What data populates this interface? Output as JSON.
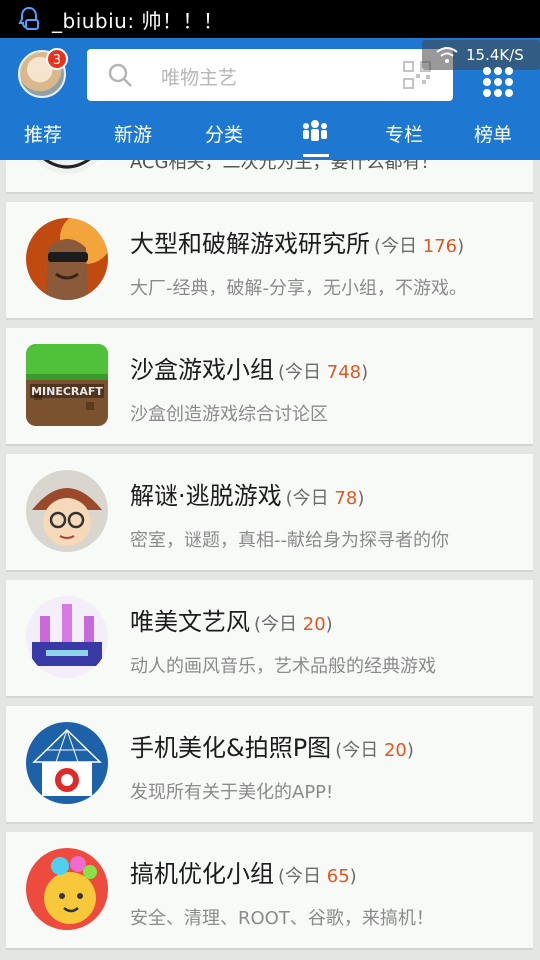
{
  "status_bar": {
    "notification": "_biubiu: 帅！！！",
    "network_speed": "15.4K/S"
  },
  "header": {
    "badge_count": "3",
    "search_placeholder": "唯物主艺",
    "tabs": [
      "推荐",
      "新游",
      "分类",
      "专栏",
      "榜单"
    ],
    "active_tab_icon": "group-icon"
  },
  "partial_item": {
    "desc": "ACG相关，二次元为主，要什么都有！"
  },
  "groups": [
    {
      "title": "大型和破解游戏研究所",
      "today_label": "今日",
      "today_count": "176",
      "desc": "大厂-经典，破解-分享，无小组，不游戏。"
    },
    {
      "title": "沙盒游戏小组",
      "today_label": "今日",
      "today_count": "748",
      "desc": "沙盒创造游戏综合讨论区"
    },
    {
      "title": "解谜·逃脱游戏",
      "today_label": "今日",
      "today_count": "78",
      "desc": "密室，谜题，真相--献给身为探寻者的你"
    },
    {
      "title": "唯美文艺风",
      "today_label": "今日",
      "today_count": "20",
      "desc": "动人的画风音乐，艺术品般的经典游戏"
    },
    {
      "title": "手机美化&拍照P图",
      "today_label": "今日",
      "today_count": "20",
      "desc": "发现所有关于美化的APP!"
    },
    {
      "title": "搞机优化小组",
      "today_label": "今日",
      "today_count": "65",
      "desc": "安全、清理、ROOT、谷歌，来搞机！"
    }
  ],
  "colors": {
    "header": "#1e78d2",
    "today_count": "#e0581f",
    "badge": "#e8321c"
  }
}
